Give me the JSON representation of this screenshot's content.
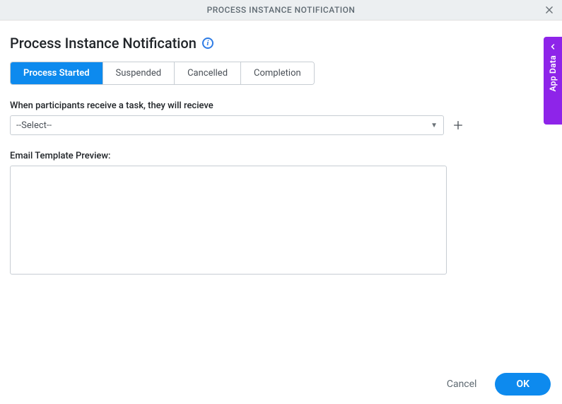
{
  "header": {
    "title": "PROCESS INSTANCE NOTIFICATION"
  },
  "page": {
    "title": "Process Instance Notification"
  },
  "tabs": [
    {
      "label": "Process Started",
      "active": true
    },
    {
      "label": "Suspended",
      "active": false
    },
    {
      "label": "Cancelled",
      "active": false
    },
    {
      "label": "Completion",
      "active": false
    }
  ],
  "form": {
    "receive_label": "When participants receive a task, they will recieve",
    "select_value": "--Select--",
    "preview_label": "Email Template Preview:"
  },
  "footer": {
    "cancel": "Cancel",
    "ok": "OK"
  },
  "side_panel": {
    "label": "App Data"
  }
}
